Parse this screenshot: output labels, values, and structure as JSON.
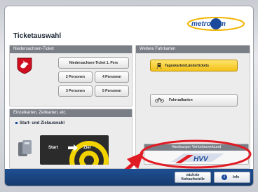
{
  "brand": {
    "logo_text": "metronom"
  },
  "page": {
    "title": "Ticketauswahl"
  },
  "left_panel": {
    "header": "Niedersachsen-Ticket",
    "ticket_1_label": "Niedersachsen-Ticket 1. Pers",
    "two_persons_label": "2 Personen",
    "four_persons_label": "4 Personen",
    "three_persons_label": "3 Personen",
    "five_persons_label": "5 Personen"
  },
  "lower_left_panel": {
    "header": "Einzelkarten, Zeitkarten, etc.",
    "subheading": "Start- und Zielauswahl",
    "start_label": "Start",
    "ziel_label": "Ziel"
  },
  "right_panel": {
    "header": "Weitere Fahrkarten",
    "tageskarten_label": "Tageskarten/Ländertickets",
    "fahrradkarten_label": "Fahrradkarten"
  },
  "hvv": {
    "header": "Hamburger Verkehrsverbund",
    "logo_text": "HVV"
  },
  "footer": {
    "next_station_label_1": "nächste",
    "next_station_label_2": "Verkaufsstelle",
    "info_label": "Info"
  },
  "colors": {
    "brand_blue": "#1b4a9c",
    "highlight_red": "#e11b24",
    "accent_yellow": "#f3c21a"
  }
}
